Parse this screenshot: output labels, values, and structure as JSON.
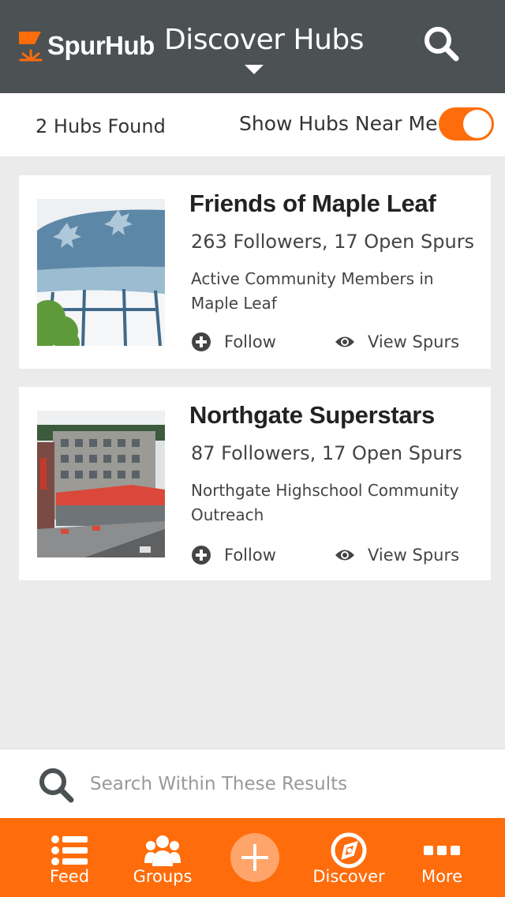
{
  "header": {
    "brand": "SpurHub",
    "title": "Discover Hubs"
  },
  "subbar": {
    "hubs_found": "2 Hubs Found",
    "near_me_label": "Show Hubs Near Me",
    "near_me_enabled": true
  },
  "cards": [
    {
      "title": "Friends of Maple Leaf",
      "stats": "263 Followers, 17 Open Spurs",
      "description": "Active Community Members in Maple Leaf",
      "follow_label": "Follow",
      "view_label": "View Spurs"
    },
    {
      "title": "Northgate Superstars",
      "stats": "87 Followers, 17 Open Spurs",
      "description": "Northgate Highschool Community Outreach",
      "follow_label": "Follow",
      "view_label": "View Spurs"
    }
  ],
  "bottom_search": {
    "placeholder": "Search Within These Results"
  },
  "tabbar": {
    "items": [
      {
        "label": "Feed",
        "icon": "list-icon"
      },
      {
        "label": "Groups",
        "icon": "people-icon"
      },
      {
        "label": "",
        "icon": "plus-icon"
      },
      {
        "label": "Discover",
        "icon": "compass-icon"
      },
      {
        "label": "More",
        "icon": "dots-icon"
      }
    ]
  },
  "colors": {
    "header_bg": "#4c5153",
    "accent": "#ff6c0b",
    "add_button": "#ffa46a",
    "page_bg": "#ebebeb"
  }
}
